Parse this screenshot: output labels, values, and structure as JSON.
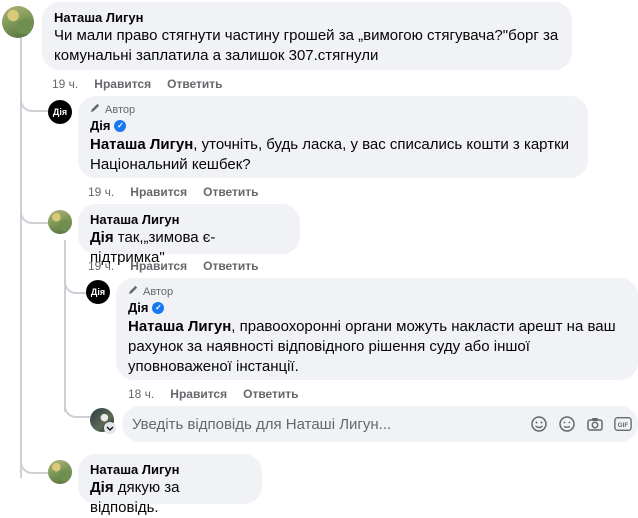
{
  "comments": [
    {
      "author": "Наташа Лигун",
      "text": "Чи мали право стягнути частину грошей за „вимогою стягувача?\"борг за комунальні заплатила а залишок 307.стягнули",
      "time": "19 ч.",
      "like": "Нравится",
      "reply": "Ответить"
    },
    {
      "author_badge": "Автор",
      "author": "Дія",
      "mention": "Наташа Лигун",
      "text": ", уточніть, будь ласка, у вас списались кошти з картки Національний кешбек?",
      "time": "19 ч.",
      "like": "Нравится",
      "reply": "Ответить"
    },
    {
      "author": "Наташа Лигун",
      "mention": "Дія",
      "text": " так,„зимова є-підтримка\"",
      "time": "19 ч.",
      "like": "Нравится",
      "reply": "Ответить"
    },
    {
      "author_badge": "Автор",
      "author": "Дія",
      "mention": "Наташа Лигун",
      "text": ", правоохоронні органи можуть накласти арешт на ваш рахунок за наявності відповідного рішення суду або іншої уповноваженої інстанції.",
      "time": "18 ч.",
      "like": "Нравится",
      "reply": "Ответить"
    },
    {
      "author": "Наташа Лигун",
      "mention": "Дія",
      "text": " дякую за відповідь.",
      "time": "",
      "like": "",
      "reply": ""
    }
  ],
  "reply_box": {
    "placeholder": "Уведіть відповідь для Наташі Лигун..."
  },
  "avatar_labels": {
    "diia": "Дія"
  },
  "colors": {
    "bubble": "#f0f2f5",
    "verified": "#1877f2",
    "meta": "#65676b"
  },
  "icons": [
    "pencil-icon",
    "verified-badge-icon",
    "emoji-icon",
    "sticker-icon",
    "camera-icon",
    "gif-icon"
  ]
}
